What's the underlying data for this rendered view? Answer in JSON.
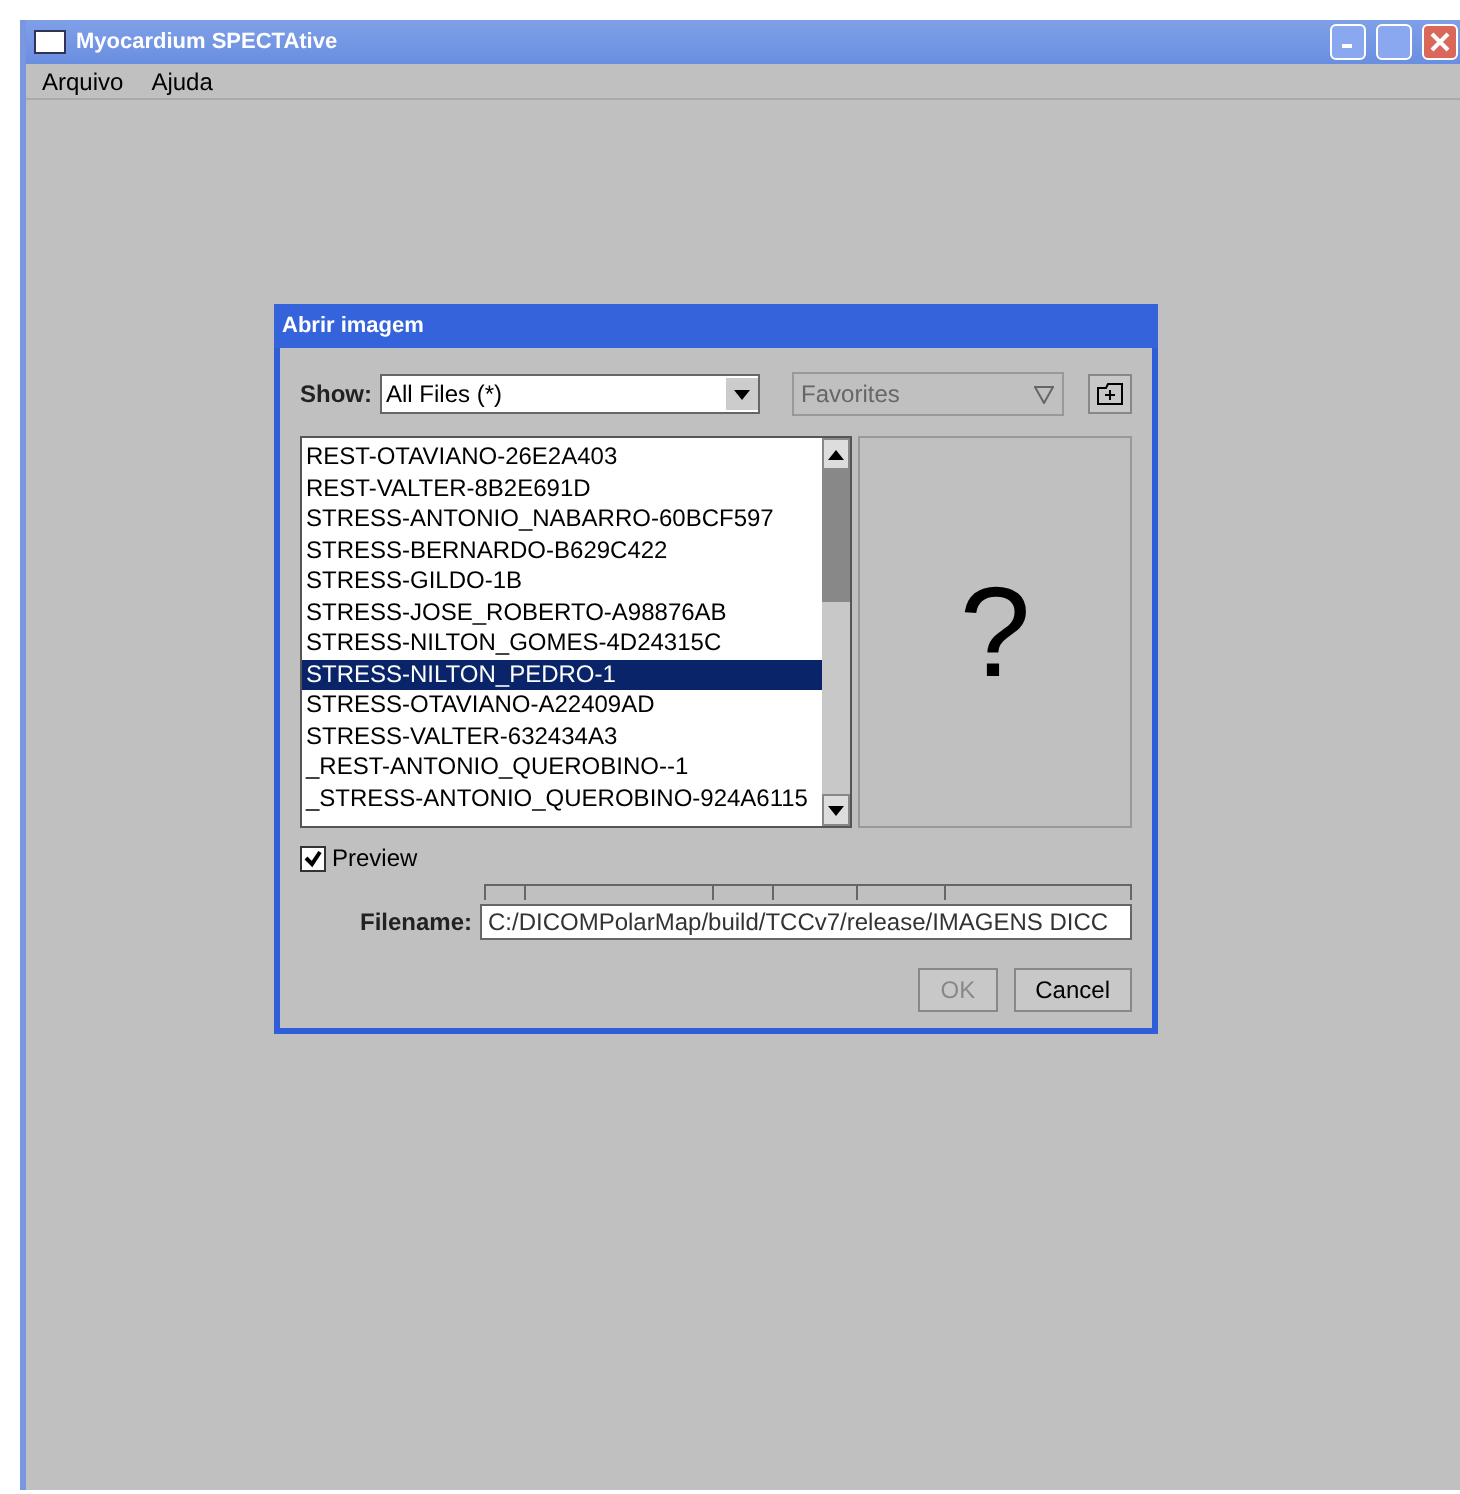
{
  "window": {
    "title": "Myocardium SPECTAtive"
  },
  "menu": [
    "Arquivo",
    "Ajuda"
  ],
  "dialog": {
    "title": "Abrir imagem",
    "show": {
      "label": "Show:",
      "value": "All Files (*)"
    },
    "favorites": {
      "value": "Favorites",
      "disabled": true
    },
    "files": [
      {
        "name": "REST-OTAVIANO-26E2A403",
        "selected": false
      },
      {
        "name": "REST-VALTER-8B2E691D",
        "selected": false
      },
      {
        "name": "STRESS-ANTONIO_NABARRO-60BCF597",
        "selected": false
      },
      {
        "name": "STRESS-BERNARDO-B629C422",
        "selected": false
      },
      {
        "name": "STRESS-GILDO-1B",
        "selected": false
      },
      {
        "name": "STRESS-JOSE_ROBERTO-A98876AB",
        "selected": false
      },
      {
        "name": "STRESS-NILTON_GOMES-4D24315C",
        "selected": false
      },
      {
        "name": "STRESS-NILTON_PEDRO-1",
        "selected": true
      },
      {
        "name": "STRESS-OTAVIANO-A22409AD",
        "selected": false
      },
      {
        "name": "STRESS-VALTER-632434A3",
        "selected": false
      },
      {
        "name": "_REST-ANTONIO_QUEROBINO--1",
        "selected": false
      },
      {
        "name": "_STRESS-ANTONIO_QUEROBINO-924A6115",
        "selected": false
      }
    ],
    "preview_symbol": "?",
    "preview": {
      "label": "Preview",
      "checked": true
    },
    "filename": {
      "label": "Filename:",
      "value": "C:/DICOMPolarMap/build/TCCv7/release/IMAGENS DICC"
    },
    "buttons": [
      {
        "label": "OK",
        "disabled": true
      },
      {
        "label": "Cancel",
        "disabled": false
      }
    ]
  }
}
